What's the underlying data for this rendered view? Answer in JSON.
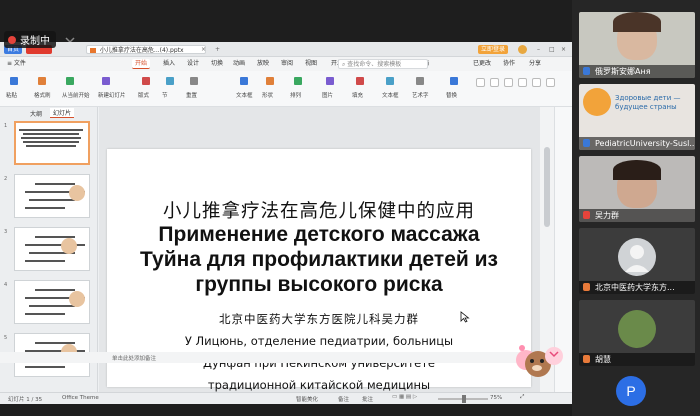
{
  "recording": {
    "label": "录制中"
  },
  "titlebar": {
    "home_label": "首页",
    "tab_label": "小儿推拿疗法在高危...(4).pptx",
    "close_glyph": "×",
    "add_glyph": "+",
    "user_label": "立即登录"
  },
  "ribbon": {
    "menu_label": "≡ 文件",
    "tabs": [
      "开始",
      "插入",
      "设计",
      "切换",
      "动画",
      "放映",
      "审阅",
      "视图",
      "开发工具",
      "会员专享",
      "智能工具箱"
    ],
    "active_index": 0,
    "search_label": "查找命令、搜索模板",
    "right_labels": [
      "已更改",
      "协作",
      "分享"
    ]
  },
  "toolbar": {
    "labels": [
      "粘贴",
      "格式刷",
      "从当前开始",
      "新建幻灯片",
      "版式",
      "节",
      "重置",
      "文本框",
      "形状",
      "排列",
      "图片",
      "填充",
      "文本框",
      "艺术字",
      "替换"
    ]
  },
  "left_panel": {
    "tabs": [
      "大纲",
      "幻灯片"
    ],
    "active_tab": 1,
    "slide_numbers": [
      "1",
      "2",
      "3",
      "4",
      "5"
    ]
  },
  "slide": {
    "title_cn": "小儿推拿疗法在高危儿保健中的应用",
    "title_ru_lines": [
      "Применение детского массажа",
      "Туйна для профилактики детей из",
      "группы высокого риска"
    ],
    "author_cn": "北京中医药大学东方医院儿科吴力群",
    "author_ru_lines": [
      "У Лицюнь, отделение педиатрии, больницы",
      "Дунфан при Пекинском университете",
      "традиционной китайской медицины"
    ]
  },
  "notes_bar": {
    "placeholder": "单击此处添加备注"
  },
  "statusbar": {
    "slide_counter": "幻灯片 1 / 35",
    "theme": "Office Theme",
    "beautify": "智能美化",
    "notes": "备注",
    "comments": "批注",
    "zoom": "75%"
  },
  "participants": [
    {
      "name": "俄罗斯安娜Аня",
      "icon": "person-icon",
      "mic": "on"
    },
    {
      "name": "PediatricUniversity-Susl...",
      "icon": "person-icon",
      "mic": "on",
      "logo_text": "Здоровые дети — будущее страны"
    },
    {
      "name": "吴力群",
      "icon": "mic-icon",
      "mic": "muted"
    },
    {
      "name": "北京中医药大学东方...",
      "icon": "host-icon",
      "mic": "muted"
    },
    {
      "name": "胡慧",
      "icon": "host-icon",
      "mic": "off"
    },
    {
      "name": "P",
      "icon": "avatar-letter",
      "mic": "off"
    }
  ],
  "colors": {
    "accent": "#2c6ee5",
    "record": "#e4433b",
    "active_tab": "#d6502b",
    "thumb_active": "#f0a060"
  }
}
